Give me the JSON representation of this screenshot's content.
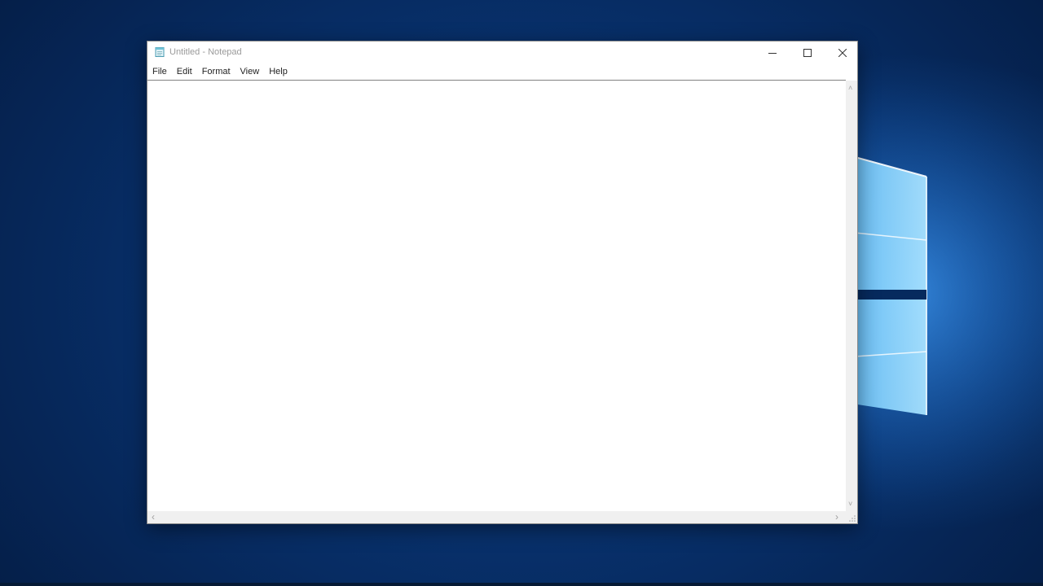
{
  "window": {
    "title": "Untitled - Notepad",
    "icon": "notepad-icon",
    "document_text": ""
  },
  "caption_buttons": {
    "minimize": "minimize-icon",
    "maximize": "maximize-icon",
    "close": "close-icon"
  },
  "menu": {
    "items": [
      {
        "label": "File"
      },
      {
        "label": "Edit"
      },
      {
        "label": "Format"
      },
      {
        "label": "View"
      },
      {
        "label": "Help"
      }
    ]
  },
  "scrollbars": {
    "up_arrow": "˄",
    "down_arrow": "˅",
    "left_arrow": "‹",
    "right_arrow": "›"
  },
  "colors": {
    "desktop_blue": "#0b3f86",
    "logo_light": "#9fdcff",
    "window_bg": "#ffffff",
    "title_text": "#9a9a9a"
  }
}
